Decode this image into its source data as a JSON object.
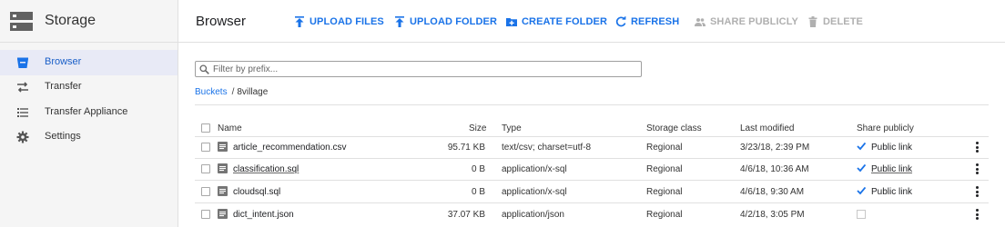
{
  "app": {
    "title": "Storage"
  },
  "sidebar": {
    "items": [
      {
        "label": "Browser",
        "icon": "bucket-icon",
        "active": true
      },
      {
        "label": "Transfer",
        "icon": "transfer-arrows-icon",
        "active": false
      },
      {
        "label": "Transfer Appliance",
        "icon": "list-icon",
        "active": false
      },
      {
        "label": "Settings",
        "icon": "gear-icon",
        "active": false
      }
    ]
  },
  "toolbar": {
    "title": "Browser",
    "upload_files": "UPLOAD FILES",
    "upload_folder": "UPLOAD FOLDER",
    "create_folder": "CREATE FOLDER",
    "refresh": "REFRESH",
    "share_publicly": "SHARE PUBLICLY",
    "delete": "DELETE"
  },
  "filter": {
    "placeholder": "Filter by prefix..."
  },
  "breadcrumb": {
    "root": "Buckets",
    "separator": "/",
    "current": "8village"
  },
  "table": {
    "headers": {
      "name": "Name",
      "size": "Size",
      "type": "Type",
      "storage_class": "Storage class",
      "last_modified": "Last modified",
      "share_publicly": "Share publicly"
    },
    "rows": [
      {
        "name": "article_recommendation.csv",
        "size": "95.71 KB",
        "type": "text/csv; charset=utf-8",
        "storage_class": "Regional",
        "last_modified": "3/23/18, 2:39 PM",
        "public": true,
        "public_label": "Public link"
      },
      {
        "name": "classification.sql",
        "size": "0 B",
        "type": "application/x-sql",
        "storage_class": "Regional",
        "last_modified": "4/6/18, 10:36 AM",
        "public": true,
        "public_label": "Public link"
      },
      {
        "name": "cloudsql.sql",
        "size": "0 B",
        "type": "application/x-sql",
        "storage_class": "Regional",
        "last_modified": "4/6/18, 9:30 AM",
        "public": true,
        "public_label": "Public link"
      },
      {
        "name": "dict_intent.json",
        "size": "37.07 KB",
        "type": "application/json",
        "storage_class": "Regional",
        "last_modified": "4/2/18, 3:05 PM",
        "public": false,
        "public_label": ""
      }
    ]
  },
  "colors": {
    "accent": "#1a73e8",
    "disabled": "#b0b0b0",
    "active_nav_bg": "#e8eaf6"
  }
}
